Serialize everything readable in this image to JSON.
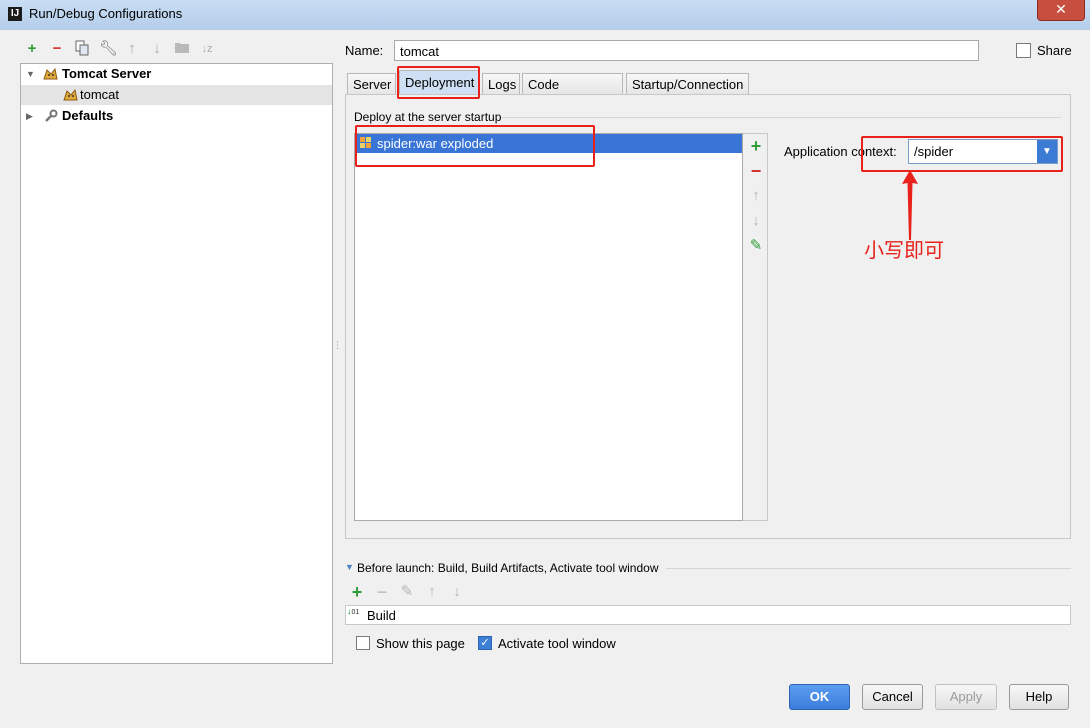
{
  "window": {
    "title": "Run/Debug Configurations",
    "app_icon": "IJ",
    "close_glyph": "✕"
  },
  "toolbar": {
    "icons": [
      "add-icon",
      "remove-icon",
      "copy-icon",
      "wrench-icon",
      "arrow-up-icon",
      "arrow-down-icon",
      "folder-icon",
      "sort-az-icon"
    ]
  },
  "tree": {
    "items": [
      {
        "label": "Tomcat Server",
        "bold": true,
        "expanded": true
      },
      {
        "label": "tomcat",
        "selected": true
      },
      {
        "label": "Defaults",
        "bold": true,
        "expanded": false
      }
    ]
  },
  "name": {
    "label": "Name:",
    "value": "tomcat"
  },
  "share": {
    "label": "Share",
    "checked": false
  },
  "tabs": [
    {
      "label": "Server"
    },
    {
      "label": "Deployment",
      "active": true
    },
    {
      "label": "Logs"
    },
    {
      "label": "Code Coverage"
    },
    {
      "label": "Startup/Connection"
    }
  ],
  "deployment": {
    "section_title": "Deploy at the server startup",
    "artifacts": [
      "spider:war exploded"
    ],
    "application_context_label": "Application context:",
    "application_context_value": "/spider"
  },
  "annotation": {
    "text": "小写即可",
    "color": "#e8211b"
  },
  "before_launch": {
    "title": "Before launch: Build, Build Artifacts, Activate tool window",
    "tasks": [
      "Build"
    ]
  },
  "options": {
    "show_this_page": {
      "label": "Show this page",
      "checked": false
    },
    "activate_tool_window": {
      "label": "Activate tool window",
      "checked": true
    }
  },
  "buttons": {
    "ok": "OK",
    "cancel": "Cancel",
    "apply": "Apply",
    "help": "Help"
  },
  "colors": {
    "accent": "#3875d7",
    "annotation": "#e8211b"
  }
}
